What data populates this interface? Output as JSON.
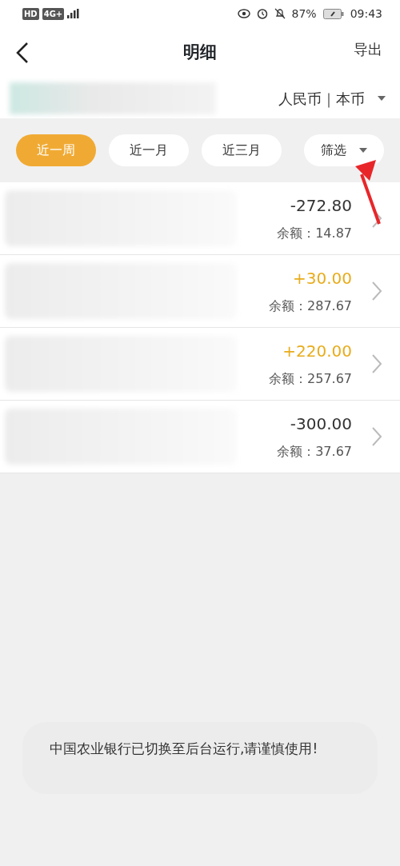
{
  "status_bar": {
    "left_icons": [
      "HD",
      "4G+"
    ],
    "battery": "87%",
    "time": "09:43"
  },
  "header": {
    "title": "明细",
    "action": "导出"
  },
  "account": {
    "currency": "人民币｜本币"
  },
  "filters": [
    {
      "label": "近一周",
      "selected": true
    },
    {
      "label": "近一月",
      "selected": false
    },
    {
      "label": "近三月",
      "selected": false
    }
  ],
  "filter_menu": {
    "label": "筛选"
  },
  "transactions": [
    {
      "amount": "-272.80",
      "kind": "expense",
      "balance": "余额：14.87"
    },
    {
      "amount": "+30.00",
      "kind": "income",
      "balance": "余额：287.67"
    },
    {
      "amount": "+220.00",
      "kind": "income",
      "balance": "余额：257.67"
    },
    {
      "amount": "-300.00",
      "kind": "expense",
      "balance": "余额：37.67"
    }
  ],
  "toast": "中国农业银行已切换至后台运行,请谨慎使用!"
}
